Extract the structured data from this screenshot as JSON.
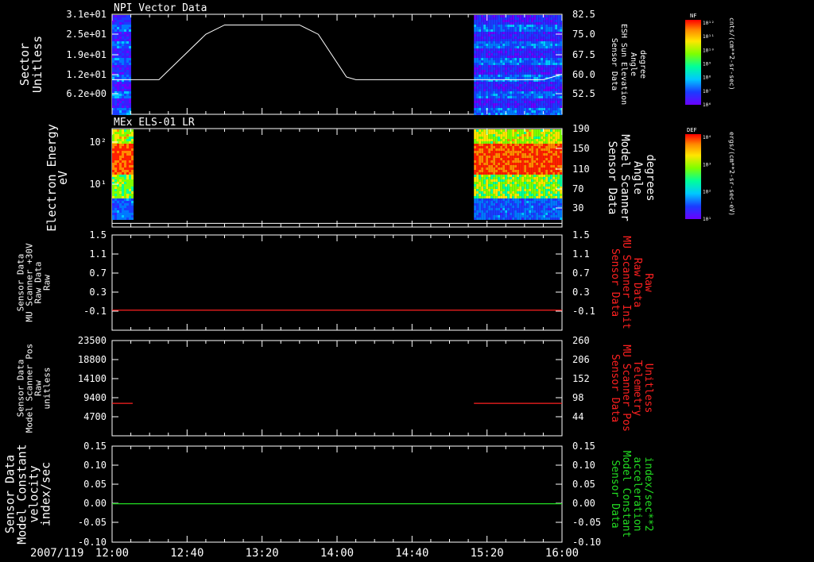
{
  "date_label": "2007/119",
  "x_ticks": [
    "12:00",
    "12:40",
    "13:20",
    "14:00",
    "14:40",
    "15:20",
    "16:00"
  ],
  "cbar1": {
    "name": "NF",
    "unit": "cnts/(cm**2-sr-sec)",
    "ticks": [
      "10¹²",
      "10¹¹",
      "10¹⁰",
      "10⁹",
      "10⁸",
      "10⁷",
      "10⁶"
    ]
  },
  "cbar2": {
    "name": "DEF",
    "unit": "ergs/(cm**2-sr-sec-eV)",
    "ticks": [
      "10⁴",
      "10³",
      "10²",
      "10¹"
    ]
  },
  "colors": {
    "axis": "#ffffff",
    "red_trace": "#ff2020",
    "green_trace": "#22dd22"
  },
  "chart_data": [
    {
      "type": "heatmap",
      "title": "NPI Vector Data",
      "ylabel_left": [
        "Sector",
        "Unitless"
      ],
      "ylabel_right": [
        "Sensor Data",
        "ESH Sun Elevation",
        "Angle",
        "degree"
      ],
      "left_ticks": [
        "3.1e+01",
        "2.5e+01",
        "1.9e+01",
        "1.2e+01",
        "6.2e+00"
      ],
      "right_ticks": [
        "82.5",
        "75.0",
        "67.5",
        "60.0",
        "52.5"
      ],
      "ylim_right": [
        45,
        82.5
      ],
      "data_intervals": [
        [
          "12:00",
          "12:10"
        ],
        [
          "15:13",
          "16:00"
        ]
      ],
      "overlay_line": {
        "name": "ESH Sun Elevation Angle",
        "x": [
          "12:00",
          "12:25",
          "12:50",
          "13:00",
          "13:40",
          "13:50",
          "14:05",
          "14:10",
          "15:50",
          "16:00"
        ],
        "y": [
          60.0,
          60.0,
          77.0,
          80.5,
          80.5,
          77.0,
          61.0,
          60.0,
          60.0,
          62.0
        ]
      }
    },
    {
      "type": "heatmap",
      "title": "MEx ELS-01 LR",
      "ylabel_left": [
        "Electron Energy",
        "eV"
      ],
      "ylabel_right": [
        "Sensor Data",
        "Model Scanner",
        "Angle",
        "degrees"
      ],
      "left_ticks": [
        "10²",
        "10¹"
      ],
      "right_ticks": [
        "190",
        "150",
        "110",
        "70",
        "30"
      ],
      "ylim_right": [
        0,
        190
      ],
      "data_intervals": [
        [
          "12:00",
          "12:11"
        ],
        [
          "15:13",
          "16:00"
        ]
      ],
      "overlay_line": {
        "name": "Model Scanner Angle",
        "x": [
          "12:00",
          "16:00"
        ],
        "y": [
          7,
          7
        ]
      }
    },
    {
      "type": "line",
      "ylabel_left": [
        "Sensor Data",
        "MU Scanner +30V",
        "Raw Data",
        "Raw"
      ],
      "ylabel_right": [
        "Sensor Data",
        "MU Scanner Init",
        "Raw Data",
        "Raw"
      ],
      "left_ticks": [
        "1.5",
        "1.1",
        "0.7",
        "0.3",
        "-0.1"
      ],
      "right_ticks": [
        "1.5",
        "1.1",
        "0.7",
        "0.3",
        "-0.1"
      ],
      "ylim": [
        -0.4,
        1.5
      ],
      "series": [
        {
          "x": [
            "12:00",
            "16:00"
          ],
          "y": [
            0.0,
            0.0
          ],
          "color": "#ff2020"
        }
      ]
    },
    {
      "type": "line",
      "ylabel_left": [
        "Sensor Data",
        "Model Scanner Pos",
        "Raw",
        "unitless"
      ],
      "ylabel_right": [
        "Sensor Data",
        "MU Scanner Pos",
        "Telemetry",
        "Unitless"
      ],
      "left_ticks": [
        "23500",
        "18800",
        "14100",
        "9400",
        "4700"
      ],
      "right_ticks": [
        "260",
        "206",
        "152",
        "98",
        "44"
      ],
      "ylim_left": [
        0,
        23500
      ],
      "ylim_right": [
        -10,
        260
      ],
      "series": [
        {
          "x": [
            "12:00",
            "12:11"
          ],
          "y": [
            8000,
            8000
          ],
          "color": "#ff2020"
        },
        {
          "x": [
            "15:13",
            "16:00"
          ],
          "y": [
            8000,
            8000
          ],
          "color": "#ff2020"
        }
      ]
    },
    {
      "type": "line",
      "ylabel_left": [
        "Sensor Data",
        "Model Constant",
        "velocity",
        "index/sec"
      ],
      "ylabel_right": [
        "Sensor Data",
        "Model Constant",
        "acceleration",
        "index/sec**2"
      ],
      "left_ticks": [
        "0.15",
        "0.10",
        "0.05",
        "0.00",
        "-0.05",
        "-0.10"
      ],
      "right_ticks": [
        "0.15",
        "0.10",
        "0.05",
        "0.00",
        "-0.05",
        "-0.10"
      ],
      "ylim": [
        -0.1,
        0.15
      ],
      "series": [
        {
          "x": [
            "12:00",
            "16:00"
          ],
          "y": [
            0.0,
            0.0
          ],
          "color": "#22dd22"
        }
      ]
    }
  ]
}
